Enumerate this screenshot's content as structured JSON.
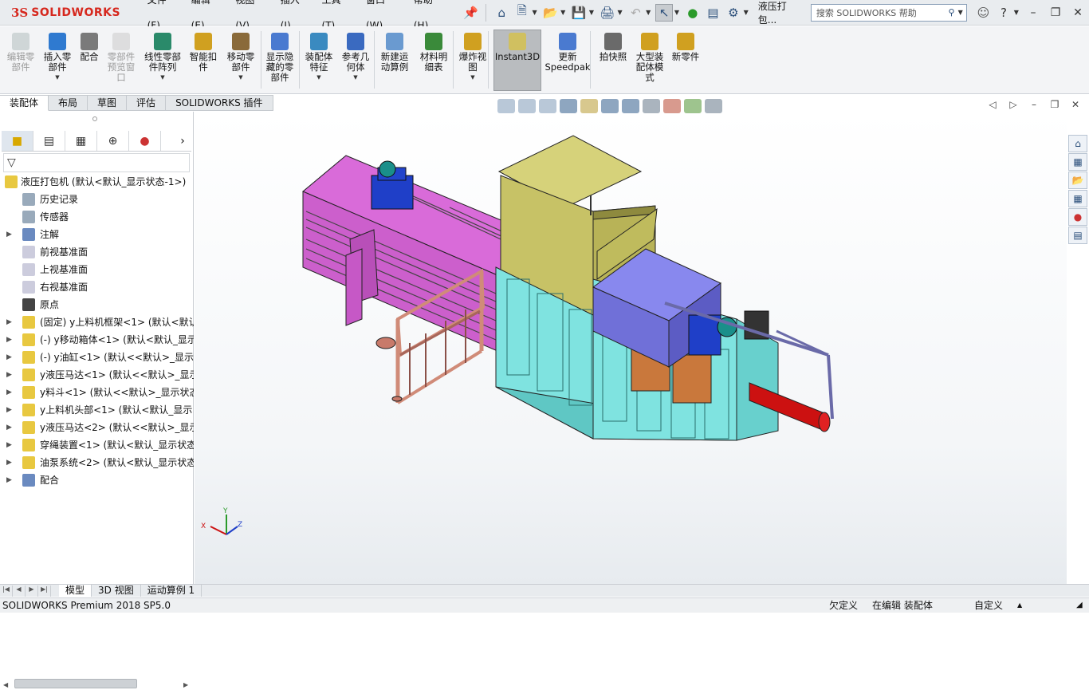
{
  "app": {
    "logo_ds": "3S",
    "logo_text": "SOLIDWORKS",
    "document_title": "液压打包..."
  },
  "menus": [
    "文件(F)",
    "编辑(E)",
    "视图(V)",
    "插入(I)",
    "工具(T)",
    "窗口(W)",
    "帮助(H)"
  ],
  "search": {
    "placeholder": "搜索 SOLIDWORKS 帮助"
  },
  "command_manager": {
    "items": [
      {
        "label": "编辑零\n部件",
        "icon": "edit-component-icon",
        "enabled": false
      },
      {
        "label": "插入零\n部件",
        "icon": "insert-component-icon",
        "enabled": true,
        "dropdown": true
      },
      {
        "label": "配合",
        "icon": "mate-icon",
        "enabled": true
      },
      {
        "label": "零部件\n预览窗\n口",
        "icon": "component-preview-icon",
        "enabled": false
      },
      {
        "label": "线性零部\n件阵列",
        "icon": "linear-pattern-icon",
        "enabled": true,
        "dropdown": true
      },
      {
        "label": "智能扣\n件",
        "icon": "smart-fasteners-icon",
        "enabled": true
      },
      {
        "label": "移动零\n部件",
        "icon": "move-component-icon",
        "enabled": true,
        "dropdown": true
      },
      {
        "label": "显示隐\n藏的零\n部件",
        "icon": "show-hidden-icon",
        "enabled": true
      },
      {
        "label": "装配体\n特征",
        "icon": "assembly-features-icon",
        "enabled": true,
        "dropdown": true
      },
      {
        "label": "参考几\n何体",
        "icon": "reference-geometry-icon",
        "enabled": true,
        "dropdown": true
      },
      {
        "label": "新建运\n动算例",
        "icon": "new-motion-study-icon",
        "enabled": true
      },
      {
        "label": "材料明\n细表",
        "icon": "bom-icon",
        "enabled": true
      },
      {
        "label": "爆炸视\n图",
        "icon": "exploded-view-icon",
        "enabled": true,
        "dropdown": true
      },
      {
        "label": "Instant3D",
        "icon": "instant3d-icon",
        "enabled": true,
        "active": true
      },
      {
        "label": "更新\nSpeedpak",
        "icon": "speedpak-icon",
        "enabled": true
      },
      {
        "label": "拍快照",
        "icon": "snapshot-icon",
        "enabled": true
      },
      {
        "label": "大型装\n配体模\n式",
        "icon": "large-assembly-icon",
        "enabled": true
      },
      {
        "label": "新零件",
        "icon": "new-part-icon",
        "enabled": true
      }
    ]
  },
  "tabs": [
    "装配体",
    "布局",
    "草图",
    "评估",
    "SOLIDWORKS 插件"
  ],
  "tree": {
    "root": "液压打包机 (默认<默认_显示状态-1>)",
    "nodes": [
      {
        "label": "历史记录",
        "icon": "history-icon",
        "expand": false
      },
      {
        "label": "传感器",
        "icon": "sensor-icon",
        "expand": false
      },
      {
        "label": "注解",
        "icon": "annotation-icon",
        "expand": true
      },
      {
        "label": "前视基准面",
        "icon": "plane-icon",
        "expand": false
      },
      {
        "label": "上视基准面",
        "icon": "plane-icon",
        "expand": false
      },
      {
        "label": "右视基准面",
        "icon": "plane-icon",
        "expand": false
      },
      {
        "label": "原点",
        "icon": "origin-icon",
        "expand": false
      },
      {
        "label": "(固定) y上料机框架<1> (默认<默认",
        "icon": "subassembly-icon",
        "expand": true
      },
      {
        "label": "(-) y移动箱体<1> (默认<默认_显示",
        "icon": "subassembly-icon",
        "expand": true
      },
      {
        "label": "(-) y油缸<1> (默认<<默认>_显示",
        "icon": "subassembly-icon",
        "expand": true
      },
      {
        "label": "y液压马达<1> (默认<<默认>_显示",
        "icon": "subassembly-icon",
        "expand": true
      },
      {
        "label": "y料斗<1> (默认<<默认>_显示状态",
        "icon": "subassembly-icon",
        "expand": true
      },
      {
        "label": "y上料机头部<1> (默认<默认_显示",
        "icon": "subassembly-icon",
        "expand": true
      },
      {
        "label": "y液压马达<2> (默认<<默认>_显示",
        "icon": "subassembly-icon",
        "expand": true
      },
      {
        "label": "穿绳装置<1> (默认<默认_显示状态",
        "icon": "subassembly-icon",
        "expand": true
      },
      {
        "label": "油泵系统<2> (默认<默认_显示状态",
        "icon": "subassembly-icon",
        "expand": true
      },
      {
        "label": "配合",
        "icon": "mates-icon",
        "expand": true
      }
    ]
  },
  "bottom_tabs": [
    "模型",
    "3D 视图",
    "运动算例 1"
  ],
  "status": {
    "product": "SOLIDWORKS Premium 2018 SP5.0",
    "definition": "欠定义",
    "mode": "在编辑 装配体",
    "units": "自定义"
  },
  "colors": {
    "magenta": "#d96bd9",
    "cyan": "#7fe3e0",
    "olive": "#c7c266",
    "violet": "#7070d8",
    "red": "#cc1111",
    "frame": "#d08b78"
  }
}
